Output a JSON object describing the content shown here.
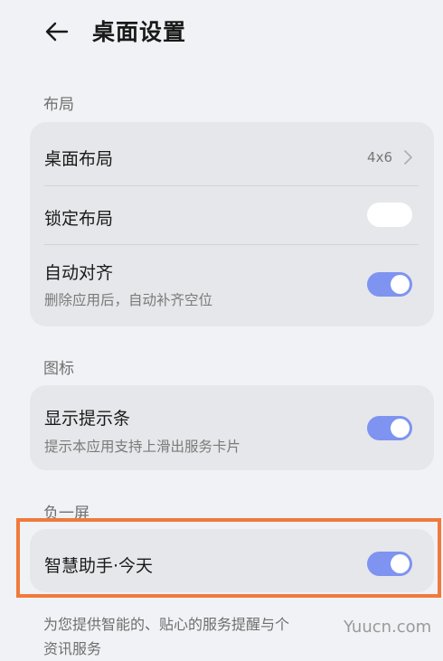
{
  "header": {
    "title": "桌面设置"
  },
  "sections": {
    "layout": {
      "label": "布局",
      "desktop_layout": {
        "title": "桌面布局",
        "value": "4x6"
      },
      "lock_layout": {
        "title": "锁定布局",
        "enabled": false
      },
      "auto_align": {
        "title": "自动对齐",
        "subtitle": "删除应用后，自动补齐空位",
        "enabled": true
      }
    },
    "icons": {
      "label": "图标",
      "show_hint_bar": {
        "title": "显示提示条",
        "subtitle": "提示本应用支持上滑出服务卡片",
        "enabled": true
      }
    },
    "minus_one_screen": {
      "label": "负一屏",
      "smart_assistant": {
        "title": "智慧助手·今天",
        "enabled": true
      },
      "description": "为您提供智能的、贴心的服务提醒与个\n资讯服务"
    }
  },
  "watermark": "Yuucn.com",
  "colors": {
    "toggle_on": "#7f93f1",
    "highlight": "#f07a3c",
    "background": "#f1f2f5",
    "card": "#e6e7ea"
  }
}
